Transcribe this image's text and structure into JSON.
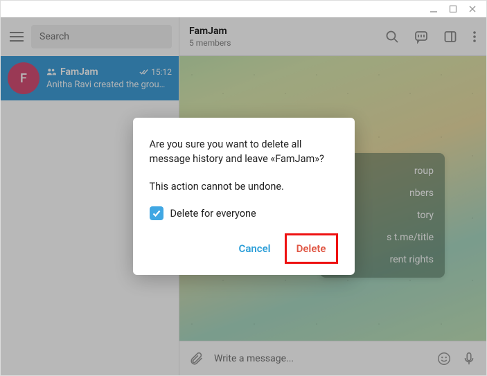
{
  "window_controls": {
    "minimize": "minimize",
    "maximize": "maximize",
    "close": "close"
  },
  "sidebar": {
    "search_placeholder": "Search",
    "chat": {
      "avatar_letter": "F",
      "name": "FamJam",
      "time": "15:12",
      "subtitle": "Anitha Ravi created the grou…"
    }
  },
  "header": {
    "title": "FamJam",
    "subtitle": "5 members"
  },
  "menu": {
    "items": [
      "roup",
      "nbers",
      "tory",
      "s t.me/title",
      "rent rights"
    ]
  },
  "composer": {
    "placeholder": "Write a message..."
  },
  "dialog": {
    "line1": "Are you sure you want to delete all message history and leave «FamJam»?",
    "line2": "This action cannot be undone.",
    "checkbox_label": "Delete for everyone",
    "cancel": "Cancel",
    "delete": "Delete"
  }
}
